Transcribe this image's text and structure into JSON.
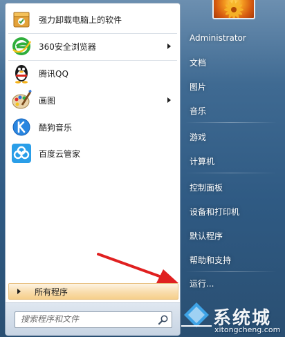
{
  "programs": [
    {
      "label": "强力卸载电脑上的软件",
      "icon": "uninstall-box-icon",
      "submenu": false
    },
    {
      "label": "360安全浏览器",
      "icon": "360-browser-icon",
      "submenu": true
    },
    {
      "label": "腾讯QQ",
      "icon": "qq-penguin-icon",
      "submenu": false
    },
    {
      "label": "画图",
      "icon": "paint-palette-icon",
      "submenu": true
    },
    {
      "label": "酷狗音乐",
      "icon": "kugou-music-icon",
      "submenu": false
    },
    {
      "label": "百度云管家",
      "icon": "baidu-cloud-icon",
      "submenu": false
    }
  ],
  "all_programs": "所有程序",
  "search": {
    "placeholder": "搜索程序和文件"
  },
  "right_items": [
    "Administrator",
    "文档",
    "图片",
    "音乐",
    "游戏",
    "计算机",
    "控制面板",
    "设备和打印机",
    "默认程序",
    "帮助和支持",
    "运行..."
  ],
  "watermark": {
    "title": "系统城",
    "url": "xitongcheng.com"
  },
  "colors": {
    "annotation_arrow": "#e02020",
    "all_programs_highlight": "#f9deb0",
    "panel_glass": "#3f6a92"
  }
}
